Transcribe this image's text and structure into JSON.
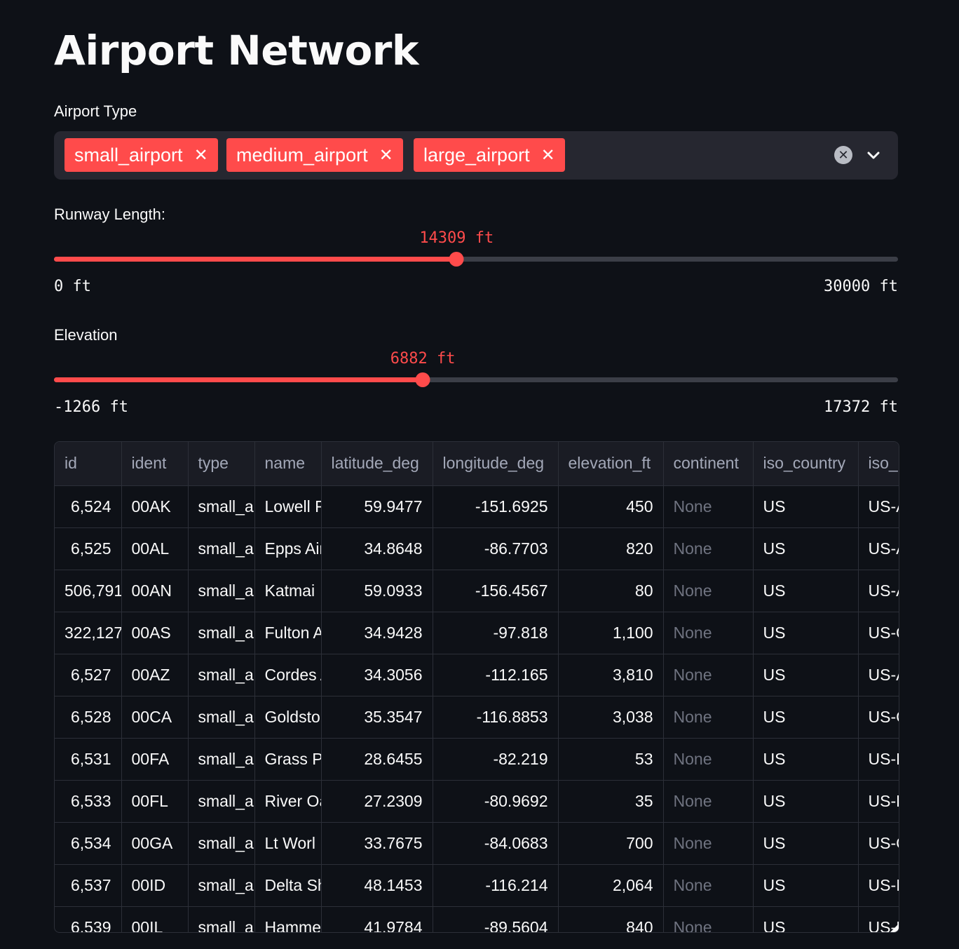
{
  "title": "Airport Network",
  "airport_type": {
    "label": "Airport Type",
    "selected": [
      "small_airport",
      "medium_airport",
      "large_airport"
    ]
  },
  "runway": {
    "label": "Runway Length:",
    "value": "14309 ft",
    "min": "0 ft",
    "max": "30000 ft",
    "fraction": 0.477
  },
  "elevation": {
    "label": "Elevation",
    "value": "6882 ft",
    "min": "-1266 ft",
    "max": "17372 ft",
    "fraction": 0.437
  },
  "table": {
    "columns": [
      "id",
      "ident",
      "type",
      "name",
      "latitude_deg",
      "longitude_deg",
      "elevation_ft",
      "continent",
      "iso_country",
      "iso_"
    ],
    "rows": [
      [
        "6,524",
        "00AK",
        "small_a",
        "Lowell F",
        "59.9477",
        "-151.6925",
        "450",
        "None",
        "US",
        "US-A"
      ],
      [
        "6,525",
        "00AL",
        "small_a",
        "Epps Air",
        "34.8648",
        "-86.7703",
        "820",
        "None",
        "US",
        "US-A"
      ],
      [
        "506,791",
        "00AN",
        "small_a",
        "Katmai",
        "59.0933",
        "-156.4567",
        "80",
        "None",
        "US",
        "US-A"
      ],
      [
        "322,127",
        "00AS",
        "small_a",
        "Fulton A",
        "34.9428",
        "-97.818",
        "1,100",
        "None",
        "US",
        "US-O"
      ],
      [
        "6,527",
        "00AZ",
        "small_a",
        "Cordes A",
        "34.3056",
        "-112.165",
        "3,810",
        "None",
        "US",
        "US-A"
      ],
      [
        "6,528",
        "00CA",
        "small_a",
        "Goldsto",
        "35.3547",
        "-116.8853",
        "3,038",
        "None",
        "US",
        "US-C"
      ],
      [
        "6,531",
        "00FA",
        "small_a",
        "Grass Pa",
        "28.6455",
        "-82.219",
        "53",
        "None",
        "US",
        "US-F"
      ],
      [
        "6,533",
        "00FL",
        "small_a",
        "River Oa",
        "27.2309",
        "-80.9692",
        "35",
        "None",
        "US",
        "US-F"
      ],
      [
        "6,534",
        "00GA",
        "small_a",
        "Lt Worl",
        "33.7675",
        "-84.0683",
        "700",
        "None",
        "US",
        "US-G"
      ],
      [
        "6,537",
        "00ID",
        "small_a",
        "Delta Sh",
        "48.1453",
        "-116.214",
        "2,064",
        "None",
        "US",
        "US-I"
      ],
      [
        "6,539",
        "00IL",
        "small_a",
        "Hammer",
        "41.9784",
        "-89.5604",
        "840",
        "None",
        "US",
        "US-I"
      ]
    ]
  }
}
